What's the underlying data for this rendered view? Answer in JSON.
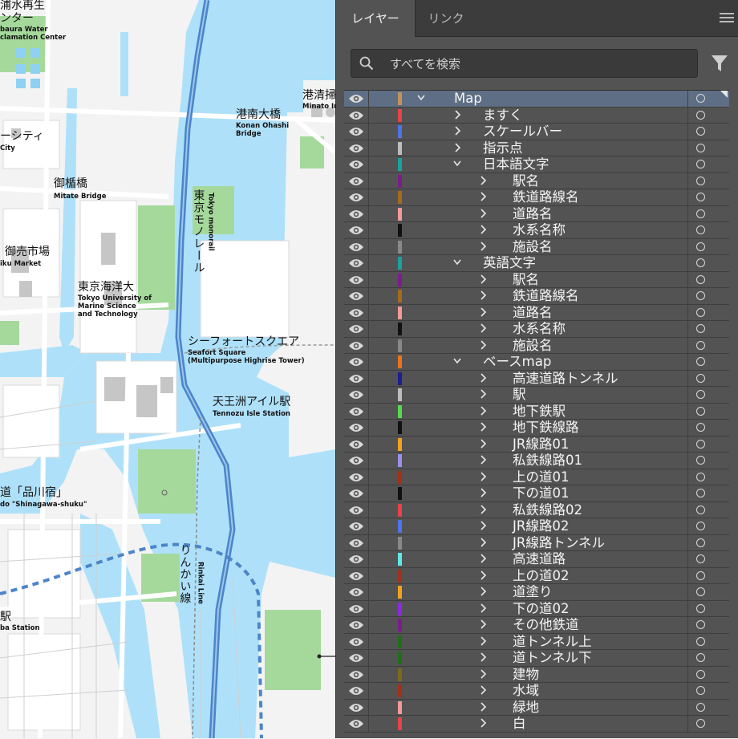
{
  "map": {
    "labels": [
      {
        "name": "reclamation-center-jp1",
        "text": "浦水再生"
      },
      {
        "name": "reclamation-center-jp2",
        "text": "ンター"
      },
      {
        "name": "reclamation-center-en1",
        "text": "baura Water"
      },
      {
        "name": "reclamation-center-en2",
        "text": "clamation Center"
      },
      {
        "name": "city-jp",
        "text": "ーシティ"
      },
      {
        "name": "city-en",
        "text": "City"
      },
      {
        "name": "konan-bridge-jp",
        "text": "港南大橋"
      },
      {
        "name": "konan-bridge-en1",
        "text": "Konan Ohashi"
      },
      {
        "name": "konan-bridge-en2",
        "text": "Bridge"
      },
      {
        "name": "minato-jp",
        "text": "港清掃"
      },
      {
        "name": "minato-en",
        "text": "Minato In"
      },
      {
        "name": "mitate-bridge-jp",
        "text": "御楯橋"
      },
      {
        "name": "mitate-bridge-en",
        "text": "Mitate Bridge"
      },
      {
        "name": "monorail-jp",
        "text": "東京モノレール"
      },
      {
        "name": "monorail-en",
        "text": "Tokyo monorail"
      },
      {
        "name": "market-jp",
        "text": "御売市場"
      },
      {
        "name": "market-en",
        "text": "iku Market"
      },
      {
        "name": "university-jp",
        "text": "東京海洋大"
      },
      {
        "name": "university-en1",
        "text": "Tokyo University of"
      },
      {
        "name": "university-en2",
        "text": "Marine Science"
      },
      {
        "name": "university-en3",
        "text": "and Technology"
      },
      {
        "name": "seafort-jp",
        "text": "シーフォートスクエア"
      },
      {
        "name": "seafort-en1",
        "text": "Seafort Square"
      },
      {
        "name": "seafort-en2",
        "text": "(Multipurpose Highrise Tower)"
      },
      {
        "name": "tennozu-jp",
        "text": "天王洲アイル駅"
      },
      {
        "name": "tennozu-en",
        "text": "Tennozu Isle Station"
      },
      {
        "name": "shinagawa-jp",
        "text": "道「品川宿」"
      },
      {
        "name": "shinagawa-en",
        "text": "do \"Shinagawa-shuku\""
      },
      {
        "name": "rinkai-jp",
        "text": "りんかい線"
      },
      {
        "name": "rinkai-en",
        "text": "Rinkai Line"
      },
      {
        "name": "station-jp",
        "text": "駅"
      },
      {
        "name": "station-en",
        "text": "ba Station"
      }
    ]
  },
  "panel": {
    "tabs": [
      {
        "label": "レイヤー"
      },
      {
        "label": "リンク"
      }
    ],
    "search_placeholder": "すべてを検索",
    "layers": [
      {
        "name": "Map",
        "depth": 0,
        "expanded": true,
        "color": "#c4915a",
        "selected": true
      },
      {
        "name": "ますく",
        "depth": 1,
        "expanded": false,
        "color": "#e8424a"
      },
      {
        "name": "スケールバー",
        "depth": 1,
        "expanded": false,
        "color": "#4f73e8"
      },
      {
        "name": "指示点",
        "depth": 1,
        "expanded": false,
        "color": "#bdbdbd"
      },
      {
        "name": "日本語文字",
        "depth": 1,
        "expanded": true,
        "color": "#1aa2a0"
      },
      {
        "name": "駅名",
        "depth": 2,
        "expanded": false,
        "color": "#7b1e8c"
      },
      {
        "name": "鉄道路線名",
        "depth": 2,
        "expanded": false,
        "color": "#a46b1d"
      },
      {
        "name": "道路名",
        "depth": 2,
        "expanded": false,
        "color": "#f29a9a"
      },
      {
        "name": "水系名称",
        "depth": 2,
        "expanded": false,
        "color": "#111111"
      },
      {
        "name": "施設名",
        "depth": 2,
        "expanded": false,
        "color": "#888888"
      },
      {
        "name": "英語文字",
        "depth": 1,
        "expanded": true,
        "color": "#1aa2a0"
      },
      {
        "name": "駅名",
        "depth": 2,
        "expanded": false,
        "color": "#7b1e8c"
      },
      {
        "name": "鉄道路線名",
        "depth": 2,
        "expanded": false,
        "color": "#a46b1d"
      },
      {
        "name": "道路名",
        "depth": 2,
        "expanded": false,
        "color": "#f29a9a"
      },
      {
        "name": "水系名称",
        "depth": 2,
        "expanded": false,
        "color": "#111111"
      },
      {
        "name": "施設名",
        "depth": 2,
        "expanded": false,
        "color": "#888888"
      },
      {
        "name": "ベースmap",
        "depth": 1,
        "expanded": true,
        "color": "#e8741d"
      },
      {
        "name": "高速道路トンネル",
        "depth": 2,
        "expanded": false,
        "color": "#1c1f8f"
      },
      {
        "name": "駅",
        "depth": 2,
        "expanded": false,
        "color": "#bdbdbd"
      },
      {
        "name": "地下鉄駅",
        "depth": 2,
        "expanded": false,
        "color": "#52d94f"
      },
      {
        "name": "地下鉄線路",
        "depth": 2,
        "expanded": false,
        "color": "#111111"
      },
      {
        "name": "JR線路01",
        "depth": 2,
        "expanded": false,
        "color": "#f2a21d"
      },
      {
        "name": "私鉄線路01",
        "depth": 2,
        "expanded": false,
        "color": "#9b8fe8"
      },
      {
        "name": "上の道01",
        "depth": 2,
        "expanded": false,
        "color": "#a0321c"
      },
      {
        "name": "下の道01",
        "depth": 2,
        "expanded": false,
        "color": "#111111"
      },
      {
        "name": "私鉄線路02",
        "depth": 2,
        "expanded": false,
        "color": "#e8424a"
      },
      {
        "name": "JR線路02",
        "depth": 2,
        "expanded": false,
        "color": "#4f73e8"
      },
      {
        "name": "JR線路トンネル",
        "depth": 2,
        "expanded": false,
        "color": "#888888"
      },
      {
        "name": "高速道路",
        "depth": 2,
        "expanded": false,
        "color": "#5ee8e8"
      },
      {
        "name": "上の道02",
        "depth": 2,
        "expanded": false,
        "color": "#a0321c"
      },
      {
        "name": "道塗り",
        "depth": 2,
        "expanded": false,
        "color": "#f2a21d"
      },
      {
        "name": "下の道02",
        "depth": 2,
        "expanded": false,
        "color": "#8a2be2"
      },
      {
        "name": "その他鉄道",
        "depth": 2,
        "expanded": false,
        "color": "#7b1e8c"
      },
      {
        "name": "道トンネル上",
        "depth": 2,
        "expanded": false,
        "color": "#1f6e1c"
      },
      {
        "name": "道トンネル下",
        "depth": 2,
        "expanded": false,
        "color": "#1f6e1c"
      },
      {
        "name": "建物",
        "depth": 2,
        "expanded": false,
        "color": "#7a6a1c"
      },
      {
        "name": "水域",
        "depth": 2,
        "expanded": false,
        "color": "#a0321c"
      },
      {
        "name": "緑地",
        "depth": 2,
        "expanded": false,
        "color": "#f29a9a"
      },
      {
        "name": "白",
        "depth": 2,
        "expanded": false,
        "color": "#e8424a"
      }
    ]
  }
}
